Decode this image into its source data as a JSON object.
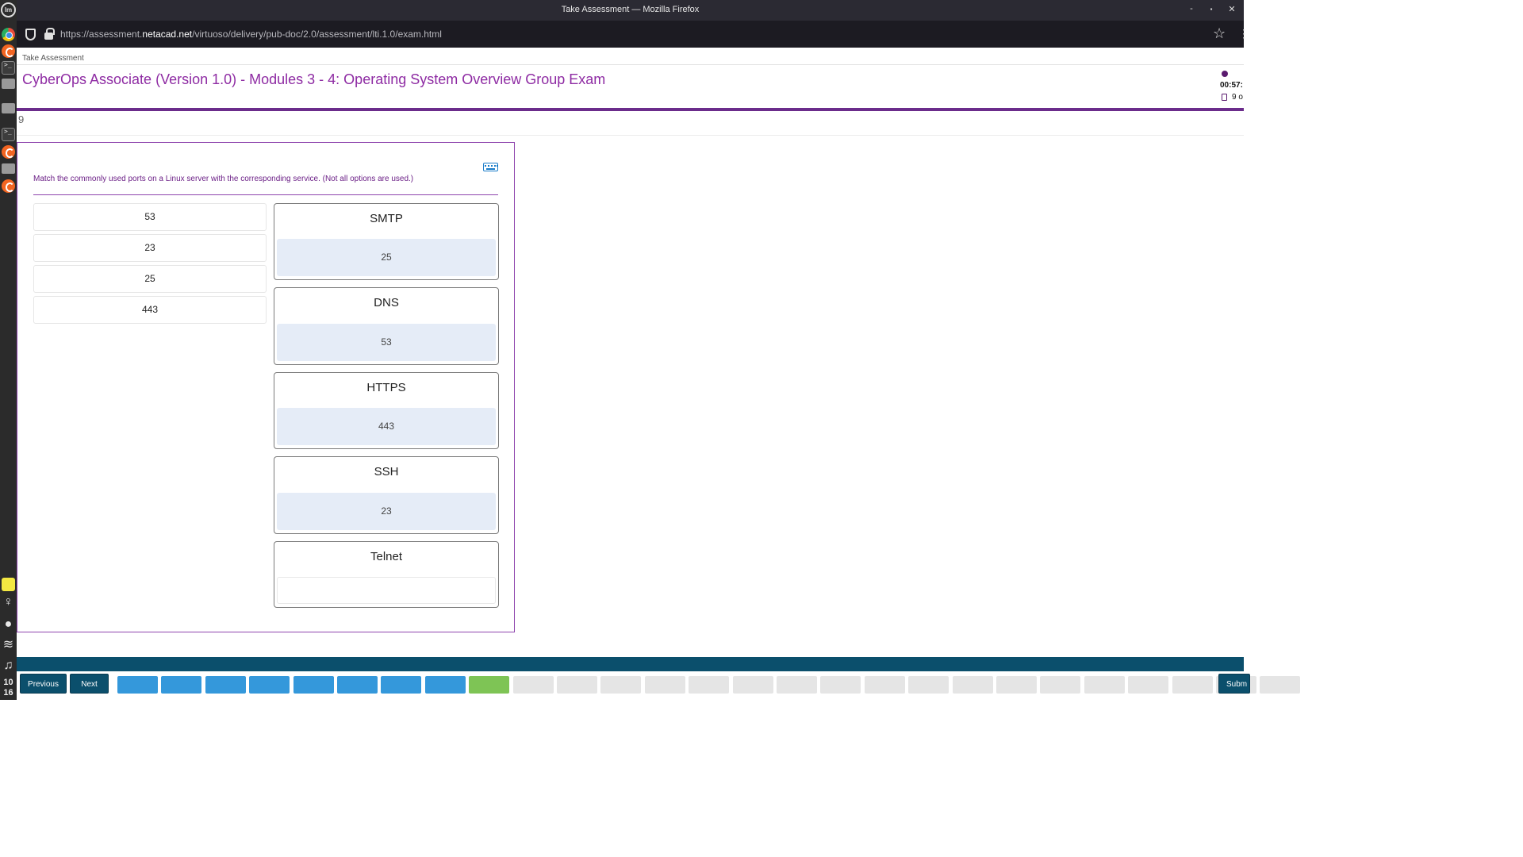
{
  "os": {
    "clock": [
      "10",
      "16"
    ]
  },
  "window": {
    "title": "Take Assessment — Mozilla Firefox",
    "controls": {
      "minimize": "-",
      "maximize": "▪",
      "close": "✕"
    }
  },
  "browser": {
    "url_prefix": "https://assessment.",
    "url_domain": "netacad.net",
    "url_path": "/virtuoso/delivery/pub-doc/2.0/assessment/lti.1.0/exam.html"
  },
  "header": {
    "breadcrumb": "Take Assessment",
    "title": "CyberOps Associate (Version 1.0) - Modules 3 - 4: Operating System Overview Group Exam",
    "timer": "00:57:",
    "progress": "9 o"
  },
  "question": {
    "number": "9",
    "prompt": "Match the commonly used ports on a Linux server with the corresponding service. (Not all options are used.)",
    "options": [
      "53",
      "23",
      "25",
      "443"
    ],
    "targets": [
      {
        "label": "SMTP",
        "answer": "25"
      },
      {
        "label": "DNS",
        "answer": "53"
      },
      {
        "label": "HTTPS",
        "answer": "443"
      },
      {
        "label": "SSH",
        "answer": "23"
      },
      {
        "label": "Telnet",
        "answer": ""
      }
    ]
  },
  "footer": {
    "previous_label": "Previous",
    "next_label": "Next",
    "submit_label": "Subm",
    "question_states": [
      "answered",
      "answered",
      "answered",
      "answered",
      "answered",
      "answered",
      "answered",
      "answered",
      "current",
      "pending",
      "pending",
      "pending",
      "pending",
      "pending",
      "pending",
      "pending",
      "pending",
      "pending",
      "pending",
      "pending",
      "pending",
      "pending",
      "pending",
      "pending",
      "pending",
      "pending",
      "pending"
    ]
  },
  "colors": {
    "accent": "#8e2ba3",
    "footer": "#0b4f6c",
    "answered": "#3498db",
    "current": "#7ec455"
  }
}
